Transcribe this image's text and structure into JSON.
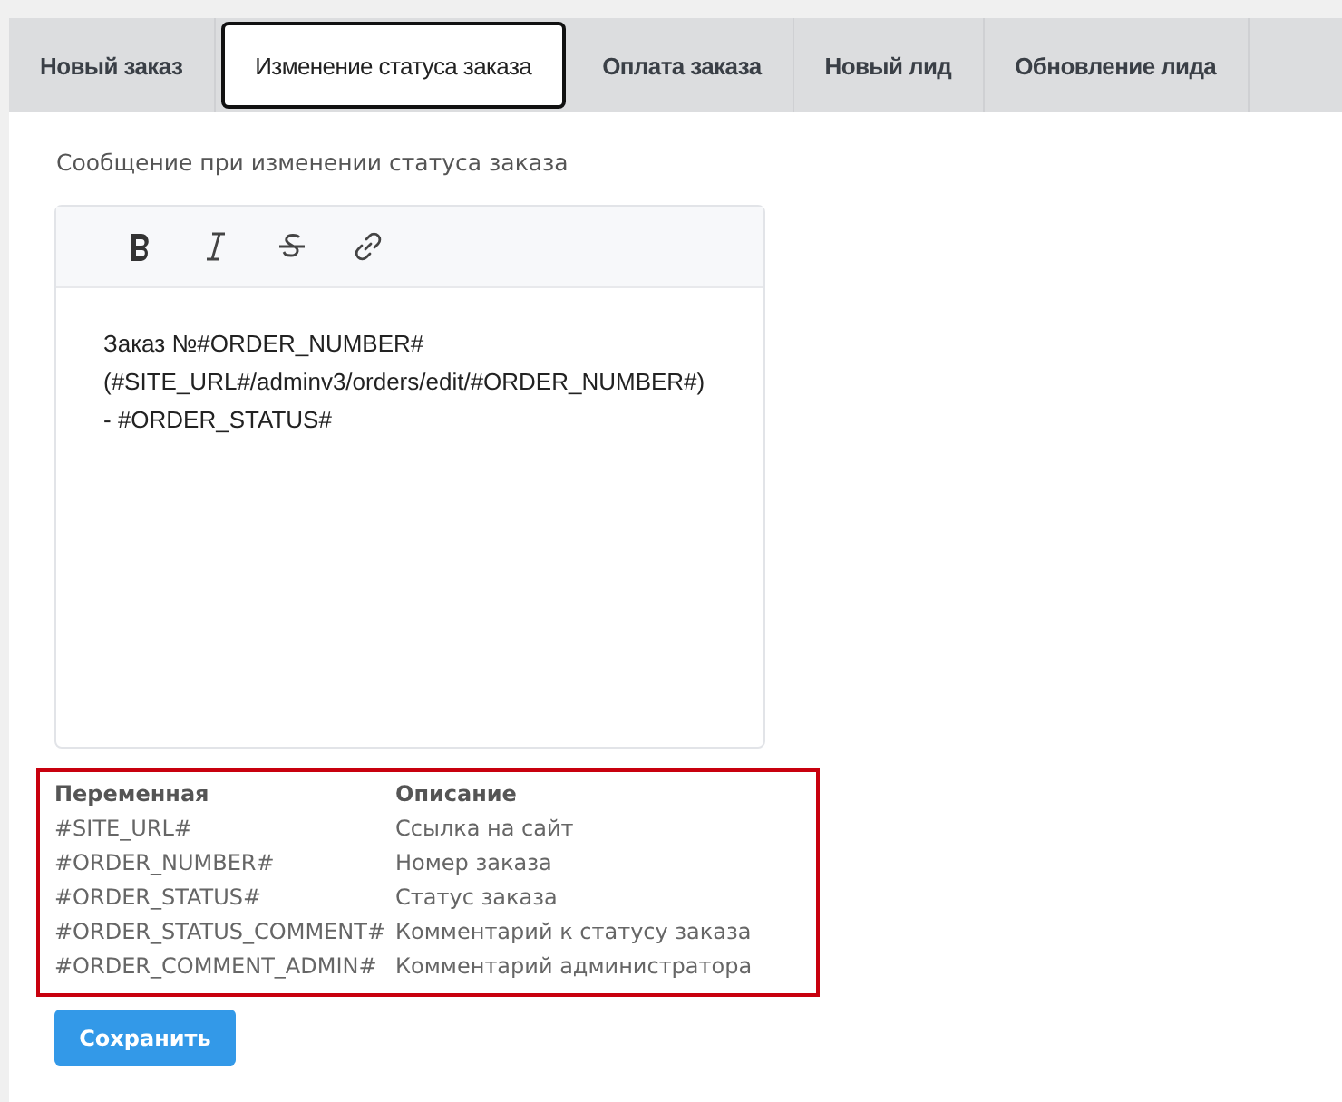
{
  "tabs": [
    {
      "label": "Новый заказ",
      "selected": false
    },
    {
      "label": "Изменение статуса заказа",
      "selected": true
    },
    {
      "label": "Оплата заказа",
      "selected": false
    },
    {
      "label": "Новый лид",
      "selected": false
    },
    {
      "label": "Обновление лида",
      "selected": false
    }
  ],
  "field_label": "Сообщение при изменении статуса заказа",
  "editor": {
    "lines": [
      "Заказ №#ORDER_NUMBER#",
      "(#SITE_URL#/adminv3/orders/edit/#ORDER_NUMBER#)",
      "- #ORDER_STATUS#"
    ]
  },
  "variables_table": {
    "columns": [
      "Переменная",
      "Описание"
    ],
    "rows": [
      [
        "#SITE_URL#",
        "Ссылка на сайт"
      ],
      [
        "#ORDER_NUMBER#",
        "Номер заказа"
      ],
      [
        "#ORDER_STATUS#",
        "Статус заказа"
      ],
      [
        "#ORDER_STATUS_COMMENT#",
        "Комментарий к статусу заказа"
      ],
      [
        "#ORDER_COMMENT_ADMIN#",
        "Комментарий администратора"
      ]
    ]
  },
  "save_button": "Сохранить"
}
